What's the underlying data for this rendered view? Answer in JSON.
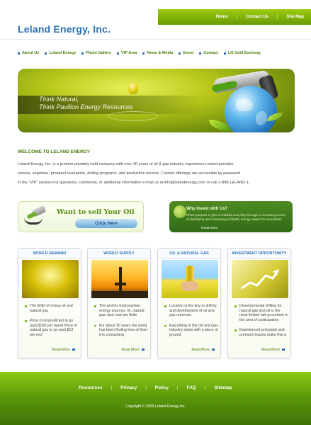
{
  "header": {
    "logo": "Leland Energy, Inc.",
    "top_links": [
      "Home",
      "Contact Us",
      "Site Map"
    ]
  },
  "nav": {
    "items": [
      "About Us",
      "Leland Energy",
      "Photo Gallery",
      "VIP Area",
      "News & Media",
      "Event",
      "Contact",
      "LN Gold Excheng"
    ]
  },
  "banner": {
    "line1": "Think Natural,",
    "line2": "Think Pavilion Energy Resources"
  },
  "welcome": {
    "heading": "WELCOME TO LELAND ENERGY",
    "line1": "Leland Energy, Inc. is a premier privately held company with over 30 years of oil & gas industry experience.Leland provides",
    "line2": "service, expertise, prospect evaluation, drilling programs, and production income. Current offerings are accessible by password",
    "line3": "in the \"VIP\" section.For questions, comments, or additional information   e-mail us at info@lelandenergy.com or call 1-888-LELAND-1."
  },
  "promo_left": {
    "title": "Want to sell Your Oil",
    "button": "Click Here"
  },
  "promo_right": {
    "title": "Why Invest with Us?",
    "body": "Prime purpose to give a residual everyday through a constant process of identifying and evaluating profitable energy targets for acquisition",
    "more": "Read More"
  },
  "cards": [
    {
      "title": "WORLD DEMAND",
      "bullets": [
        "The END of cheap oil and natural gas",
        "Price of oil predicted to go past $100 per barrel Price of natural gas to go past $13 per mcf"
      ],
      "more": "Read More"
    },
    {
      "title": "WORLD SUPPLY",
      "bullets": [
        "The world's hydrocarbon energy sources, oil, natural gas, and coal are finite",
        "For about 30 years the world has been finding less oil than it is consuming"
      ],
      "more": "Read More"
    },
    {
      "title": "OIL & NATURAL GAS",
      "bullets": [
        "Location is the key to drilling and development of oil and gas reserves.",
        "Everything in the Oil and Gas Industry starts with a piece of ground"
      ],
      "more": "Read More"
    },
    {
      "title": "INVESTMENT OPPORTUNITY",
      "bullets": [
        "Developmental drilling for natural gas and oil is the most limited risk procedure in the area of  participation",
        "Experienced principals and premium leases make this a"
      ],
      "more": "Read More"
    }
  ],
  "footer": {
    "links": [
      "Resources",
      "Privacy",
      "Policy",
      "FAQ",
      "Sitemap"
    ],
    "copyright": "Copyright © 2009 Leland Energy,Inc."
  },
  "colors": {
    "brand_blue": "#2b6fb3",
    "brand_green": "#6a9a05",
    "accent_green": "#7bbb19"
  }
}
